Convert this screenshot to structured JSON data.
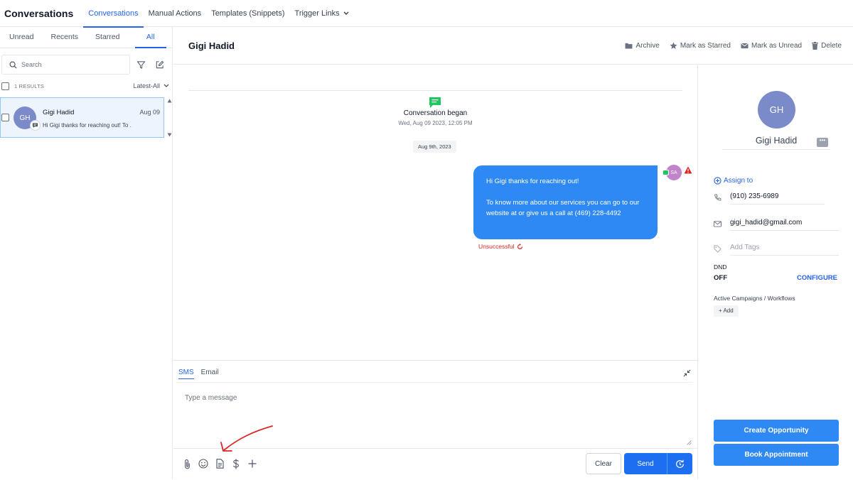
{
  "app": {
    "title": "Conversations"
  },
  "topnav": {
    "tabs": [
      {
        "label": "Conversations"
      },
      {
        "label": "Manual Actions"
      },
      {
        "label": "Templates (Snippets)"
      },
      {
        "label": "Trigger Links"
      }
    ]
  },
  "filters": {
    "tabs": [
      "Unread",
      "Recents",
      "Starred",
      "All"
    ],
    "active": "All"
  },
  "search": {
    "placeholder": "Search"
  },
  "results": {
    "count_label": "1 RESULTS",
    "sort_label": "Latest-All"
  },
  "conversations": [
    {
      "initials": "GH",
      "name": "Gigi Hadid",
      "date": "Aug 09",
      "snippet": "Hi Gigi thanks for reaching out! To ."
    }
  ],
  "chat": {
    "contact_name": "Gigi Hadid",
    "actions": {
      "archive": "Archive",
      "star": "Mark as Starred",
      "unread": "Mark as Unread",
      "delete": "Delete"
    },
    "began_title": "Conversation began",
    "began_date": "Wed, Aug 09 2023, 12:05 PM",
    "date_divider": "Aug 9th, 2023",
    "message": {
      "line1": "Hi Gigi thanks for reaching out!",
      "line2": "To know more about our services you can go to our website at  or give us a call at (469) 228-4492",
      "sender_initials": "SA",
      "status": "Unsuccessful"
    }
  },
  "composer": {
    "tabs": {
      "sms": "SMS",
      "email": "Email"
    },
    "placeholder": "Type a message",
    "clear_label": "Clear",
    "send_label": "Send"
  },
  "contact": {
    "initials": "GH",
    "name": "Gigi Hadid",
    "assign_label": "Assign to",
    "phone": "(910) 235-6989",
    "email": "gigi_hadid@gmail.com",
    "tags_placeholder": "Add Tags",
    "dnd_label": "DND",
    "dnd_value": "OFF",
    "configure_label": "CONFIGURE",
    "campaigns_label": "Active Campaigns / Workflows",
    "add_label": "Add",
    "create_opportunity": "Create Opportunity",
    "book_appointment": "Book Appointment"
  },
  "colors": {
    "accent": "#2563eb",
    "bubble": "#2f89f5",
    "error": "#dc2626",
    "avatar": "#7b8bc9"
  }
}
